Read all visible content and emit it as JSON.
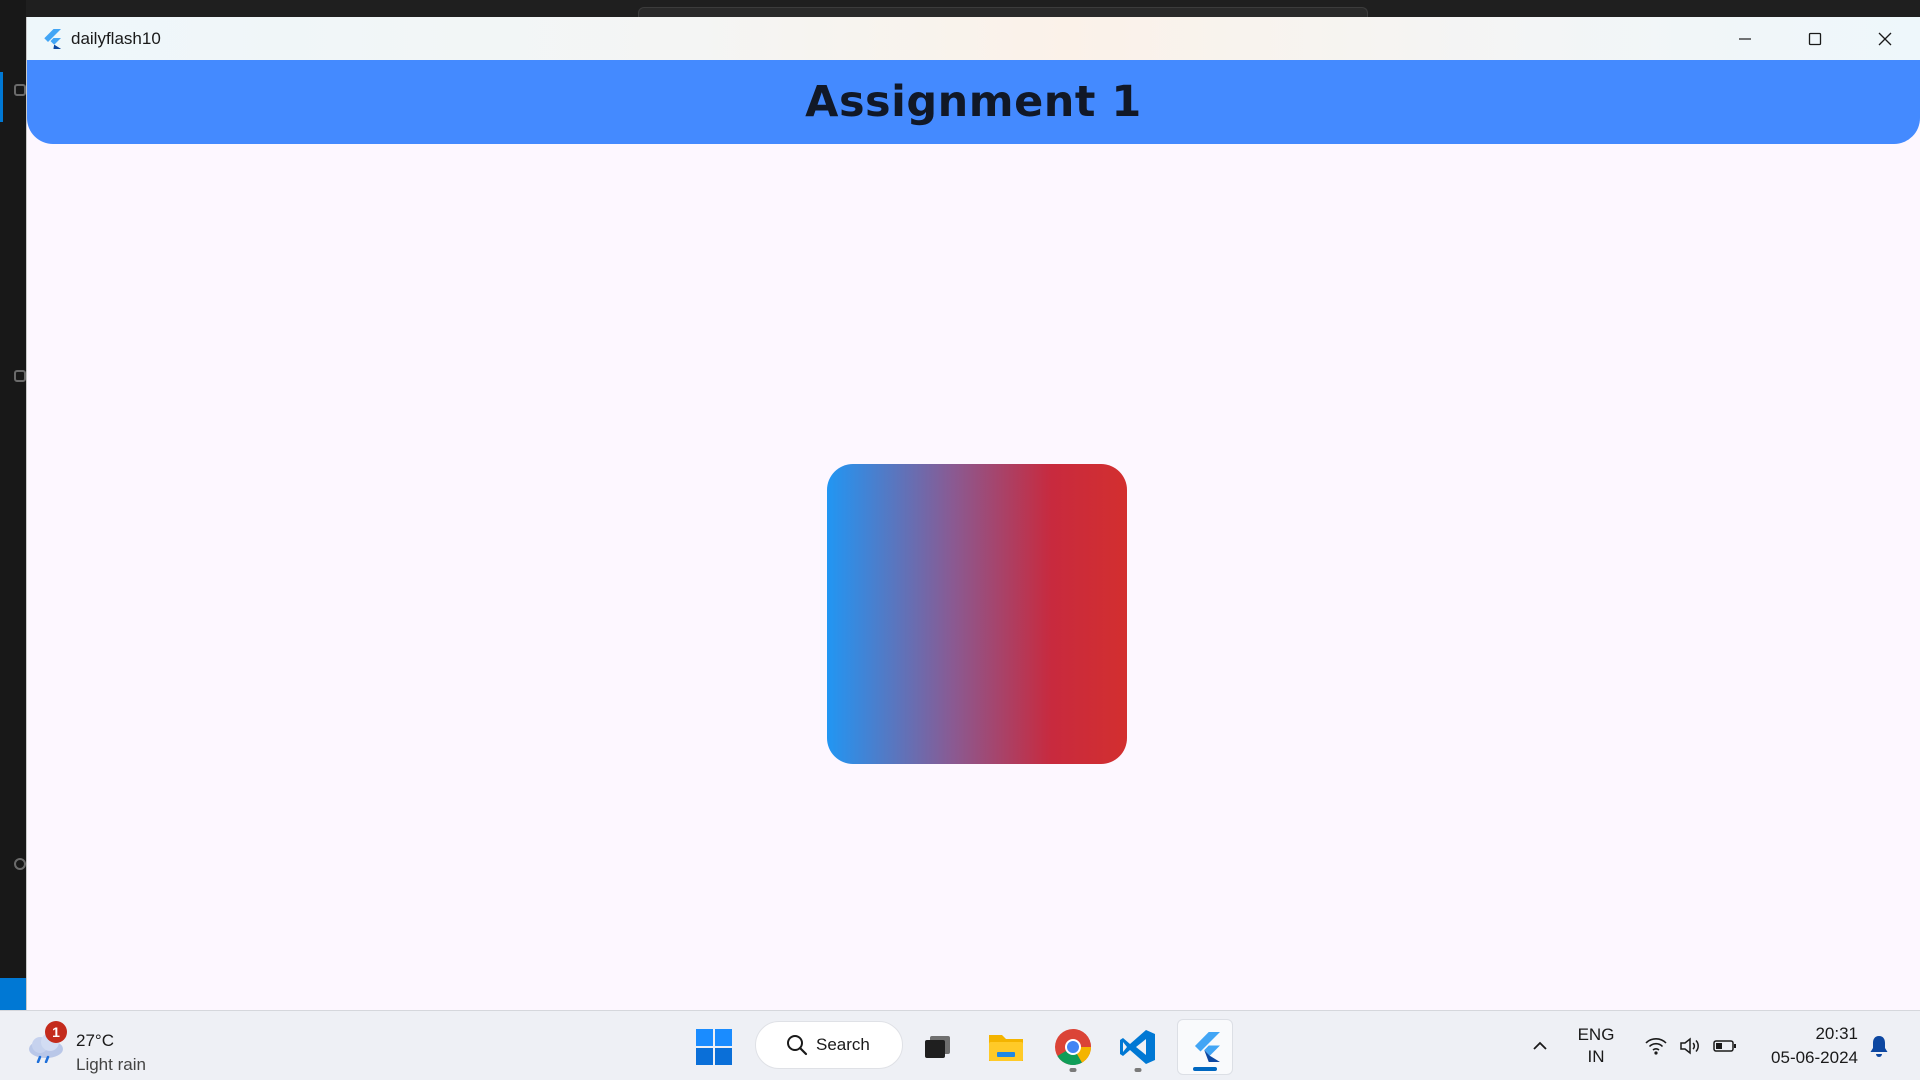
{
  "window": {
    "title": "dailyflash10"
  },
  "appbar": {
    "title": "Assignment 1"
  },
  "content": {
    "gradient_colors": [
      "#2196f3",
      "#d32f2f"
    ]
  },
  "taskbar": {
    "weather": {
      "badge": "1",
      "temperature": "27°C",
      "condition": "Light rain"
    },
    "search_label": "Search",
    "language": {
      "line1": "ENG",
      "line2": "IN"
    },
    "time": "20:31",
    "date": "05-06-2024"
  },
  "colors": {
    "appbar": "#448aff",
    "background": "#fdf7ff",
    "taskbar": "#eef0f5",
    "accent": "#0067c0"
  },
  "icons": {
    "app": "flutter-icon",
    "minimize": "minimize-icon",
    "maximize": "maximize-icon",
    "close": "close-icon",
    "start": "windows-start-icon",
    "search": "search-icon",
    "task_view": "task-view-icon",
    "file_explorer": "folder-icon",
    "chrome": "chrome-icon",
    "vscode": "vscode-icon",
    "flutter_app": "flutter-icon",
    "tray_overflow": "chevron-up-icon",
    "wifi": "wifi-icon",
    "volume": "volume-icon",
    "battery": "battery-icon",
    "notifications": "bell-icon"
  }
}
